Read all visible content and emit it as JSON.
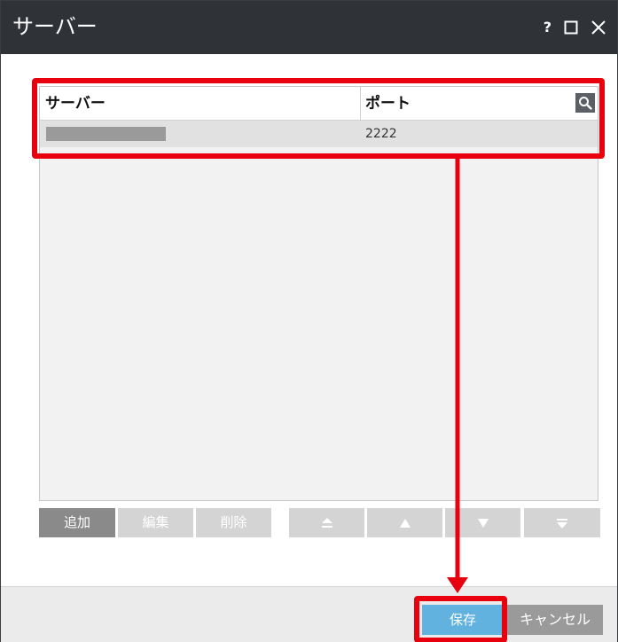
{
  "window": {
    "title": "サーバー",
    "help_label": "?"
  },
  "table": {
    "columns": [
      "サーバー",
      "ポート"
    ],
    "rows": [
      {
        "server": "",
        "port": "2222"
      }
    ]
  },
  "toolbar": {
    "add_label": "追加",
    "edit_label": "編集",
    "delete_label": "削除"
  },
  "footer": {
    "save_label": "保存",
    "cancel_label": "キャンセル"
  },
  "icons": {
    "help": "help-icon",
    "maximize": "maximize-icon",
    "close": "close-icon",
    "search": "search-icon",
    "move_top": "move-top-icon",
    "move_up": "move-up-icon",
    "move_down": "move-down-icon",
    "move_bottom": "move-bottom-icon"
  },
  "colors": {
    "titlebar": "#2f3338",
    "highlight": "#e8000f",
    "save_button": "#62b2e0",
    "cancel_button": "#9a9a9a",
    "row_selected": "#e1e1e1"
  }
}
